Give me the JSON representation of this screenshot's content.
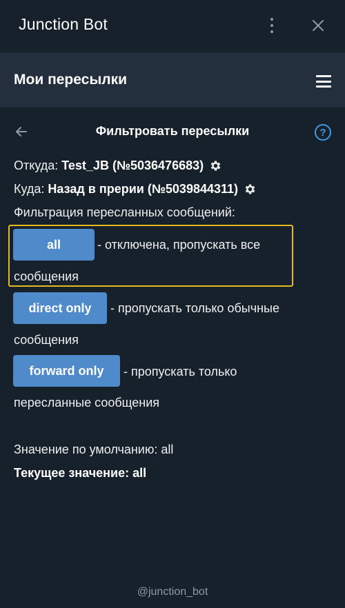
{
  "window": {
    "title": "Junction Bot",
    "icons": {
      "more": "more-vertical-icon",
      "close": "close-icon"
    }
  },
  "header": {
    "title": "Мои пересылки",
    "menu_icon": "hamburger-menu-icon"
  },
  "filter_page": {
    "title": "Фильтровать пересылки",
    "back_icon": "back-arrow-icon",
    "help_icon": "?",
    "from_label": "Откуда:",
    "from_value": "Test_JB (№5036476683)",
    "to_label": "Куда:",
    "to_value": "Назад в прерии (№5039844311)",
    "filtering_label": "Фильтрация пересланных сообщений:",
    "options": [
      {
        "button": "all",
        "desc_line1": "- отключена, пропускать все",
        "desc_line2": "сообщения"
      },
      {
        "button": "direct only",
        "desc_line1": "- пропускать только обычные",
        "desc_line2": "сообщения"
      },
      {
        "button": "forward only",
        "desc_line1": "- пропускать только",
        "desc_line2": "пересланные сообщения"
      }
    ],
    "default_label": "Значение по умолчанию: all",
    "current_label": "Текущее значение: all"
  },
  "footer": {
    "handle": "@junction_bot"
  },
  "colors": {
    "background": "#17212b",
    "header_bg": "#242f3d",
    "button_bg": "#4f8bca",
    "highlight": "#e6b822",
    "help_accent": "#3e9be6"
  }
}
